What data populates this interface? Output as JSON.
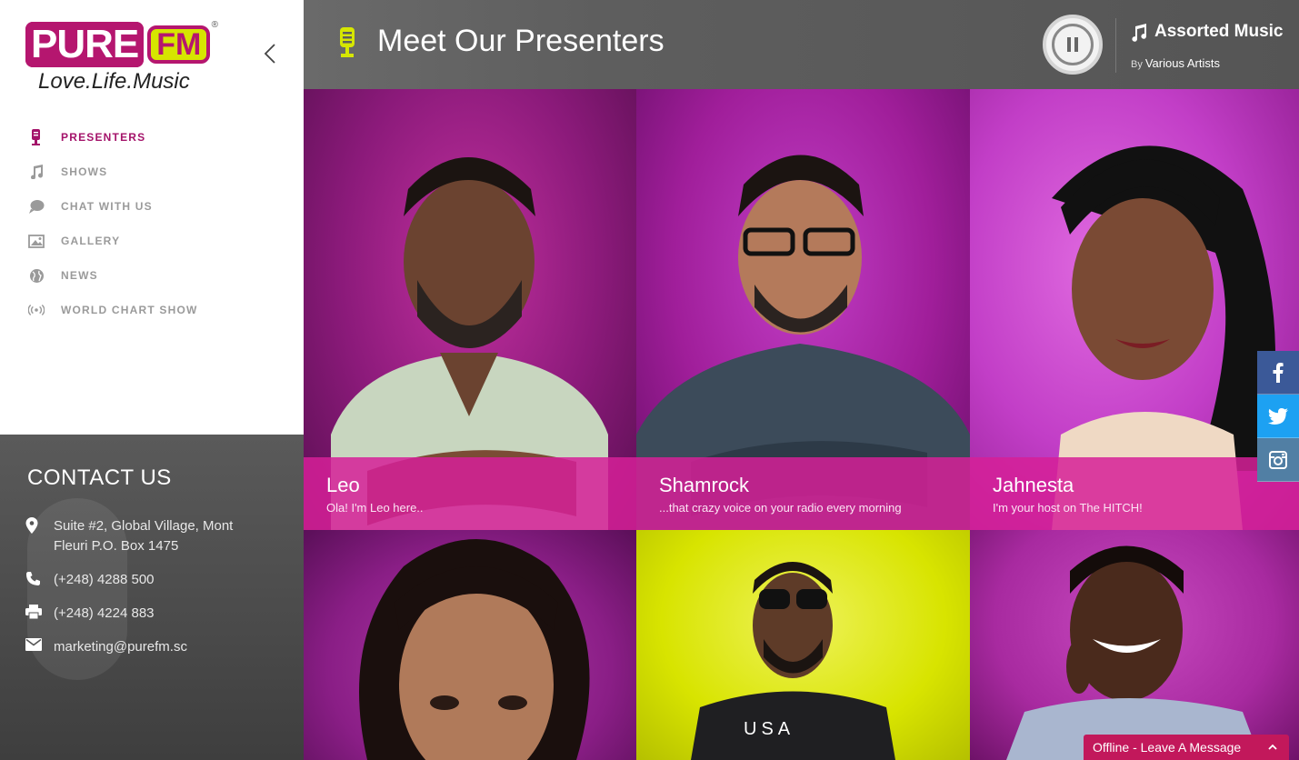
{
  "brand": {
    "logo_pure": "PURE",
    "logo_fm": "FM",
    "logo_registered": "®",
    "tagline": "Love.Life.Music",
    "accent": "#a4136a",
    "lime": "#d6e600"
  },
  "nav": {
    "items": [
      {
        "label": "PRESENTERS",
        "icon": "microphone-icon",
        "active": true
      },
      {
        "label": "SHOWS",
        "icon": "music-note-icon",
        "active": false
      },
      {
        "label": "CHAT WITH US",
        "icon": "chat-bubble-icon",
        "active": false
      },
      {
        "label": "GALLERY",
        "icon": "gallery-icon",
        "active": false
      },
      {
        "label": "NEWS",
        "icon": "globe-icon",
        "active": false
      },
      {
        "label": "WORLD CHART SHOW",
        "icon": "broadcast-icon",
        "active": false
      }
    ]
  },
  "contact": {
    "title": "CONTACT US",
    "address": "Suite #2, Global Village, Mont Fleuri P.O. Box 1475",
    "phone": "(+248) 4288 500",
    "fax": "(+248) 4224 883",
    "email": "marketing@purefm.sc"
  },
  "header": {
    "title": "Meet Our Presenters"
  },
  "player": {
    "track_title": "Assorted Music",
    "by_label": "By",
    "artist": "Various Artists",
    "state": "playing"
  },
  "presenters": [
    {
      "name": "Leo",
      "tagline": "Ola! I'm Leo here..",
      "bg": "#8b1a7a"
    },
    {
      "name": "Shamrock",
      "tagline": "...that crazy voice on your radio every morning",
      "bg": "#a01e9a"
    },
    {
      "name": "Jahnesta",
      "tagline": "I'm your host on The HITCH!",
      "bg": "#c23ec7"
    },
    {
      "name": "",
      "tagline": "",
      "bg": "#8a1e86"
    },
    {
      "name": "",
      "tagline": "",
      "bg": "#d8e400"
    },
    {
      "name": "",
      "tagline": "",
      "bg": "#a82aa0"
    }
  ],
  "social": [
    {
      "icon": "facebook-icon",
      "color": "#3b5998"
    },
    {
      "icon": "twitter-icon",
      "color": "#1da1f2"
    },
    {
      "icon": "instagram-icon",
      "color": "#517fa4"
    }
  ],
  "chat_widget": {
    "label": "Offline - Leave A Message"
  }
}
